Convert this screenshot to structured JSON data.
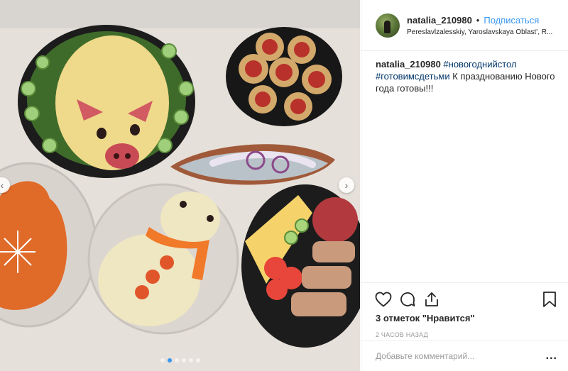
{
  "post": {
    "username": "natalia_210980",
    "separator": "•",
    "follow_label": "Подписаться",
    "location": "Pereslavlzalesskiy, Yaroslavskaya Oblast', R...",
    "caption": {
      "username": "natalia_210980",
      "hashtag_1": "#новогоднийстол",
      "hashtag_2": "#готовимсдетьми",
      "text": " К празднованию Нового года готовы!!!"
    },
    "likes_text": "3 отметок \"Нравится\"",
    "timestamp": "2 ЧАСОВ НАЗАД",
    "comment_placeholder": "Добавьте комментарий...",
    "more_label": "..."
  },
  "icons": {
    "like": "heart-icon",
    "comment": "comment-icon",
    "share": "share-icon",
    "save": "bookmark-icon",
    "prev": "chevron-left-icon",
    "next": "chevron-right-icon"
  },
  "carousel": {
    "count": 6,
    "active": 1,
    "prev_glyph": "‹",
    "next_glyph": "›"
  },
  "colors": {
    "link": "#3897f0",
    "hashtag": "#003569",
    "text": "#262626",
    "muted": "#999999"
  }
}
